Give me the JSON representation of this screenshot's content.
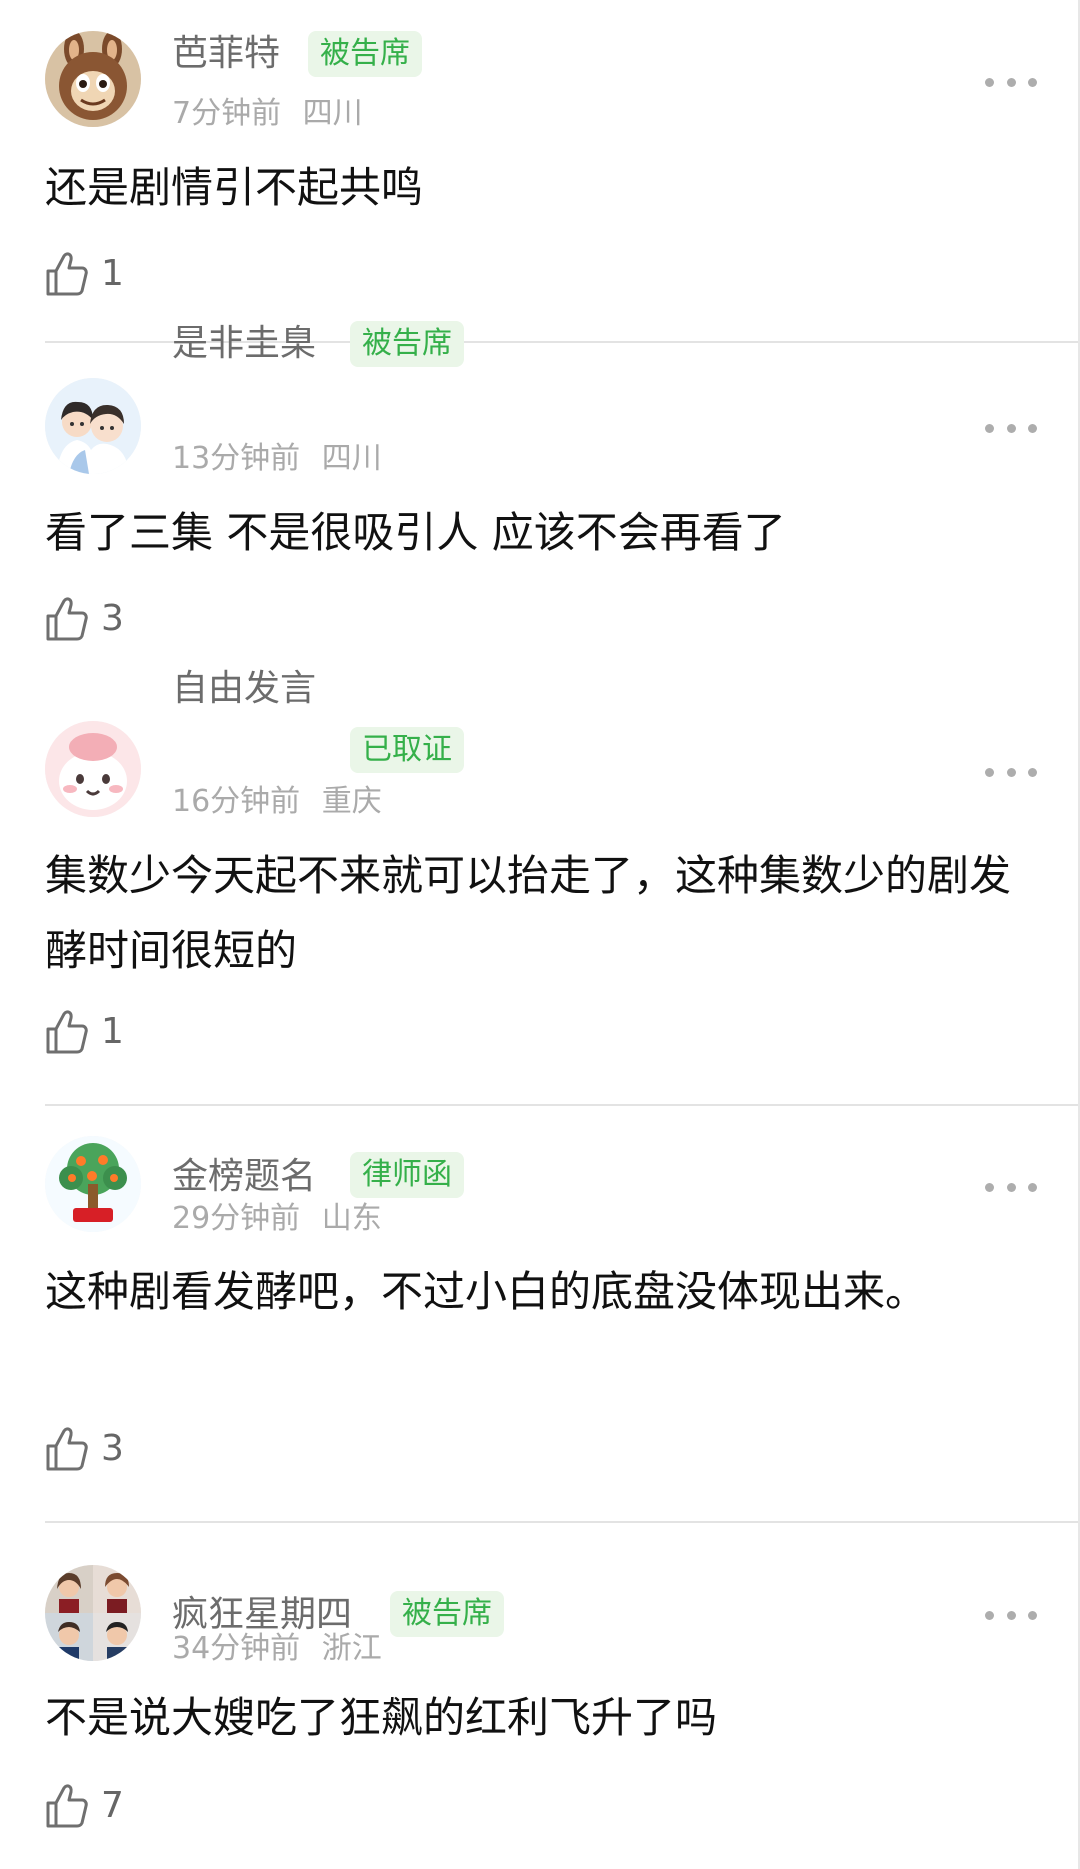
{
  "comments": [
    {
      "username": "芭菲特",
      "badge": "被告席",
      "time": "7分钟前",
      "location": "四川",
      "text": "还是剧情引不起共鸣",
      "likes": "1",
      "avatar_icon": "brown-plush-monster-avatar"
    },
    {
      "username": "是非圭臬",
      "badge": "被告席",
      "time": "13分钟前",
      "location": "四川",
      "text": "看了三集 不是很吸引人 应该不会再看了",
      "likes": "3",
      "avatar_icon": "anime-couple-avatar"
    },
    {
      "username": "自由发言",
      "badge": "已取证",
      "time": "16分钟前",
      "location": "重庆",
      "text": "集数少今天起不来就可以抬走了，这种集数少的剧发酵时间很短的",
      "likes": "1",
      "avatar_icon": "pink-cartoon-avatar"
    },
    {
      "username": "金榜题名",
      "badge": "律师函",
      "time": "29分钟前",
      "location": "山东",
      "text": "这种剧看发酵吧，不过小白的底盘没体现出来。",
      "likes": "3",
      "avatar_icon": "money-tree-avatar"
    },
    {
      "username": "疯狂星期四",
      "badge": "被告席",
      "time": "34分钟前",
      "location": "浙江",
      "text": "不是说大嫂吃了狂飙的红利飞升了吗",
      "likes": "7",
      "avatar_icon": "four-portraits-avatar"
    }
  ],
  "colors": {
    "badge_text": "#35b04a",
    "badge_bg": "#eaf6e8",
    "username": "#6c6c6c",
    "meta": "#aaaaaa",
    "body_text": "#111111"
  }
}
